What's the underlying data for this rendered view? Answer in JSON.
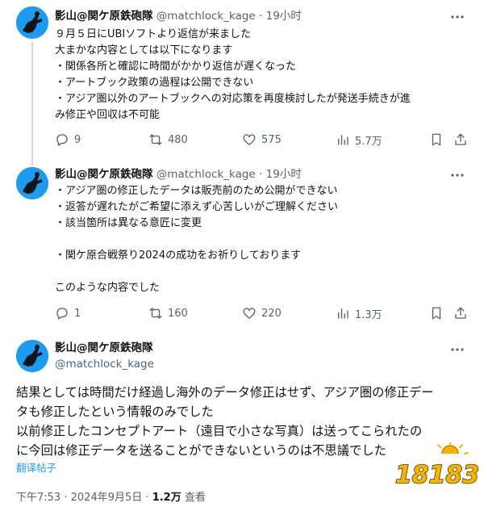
{
  "tweets": [
    {
      "name": "影山@関ケ原鉄砲隊",
      "handle": "@matchlock_kage",
      "dot": "·",
      "time": "19小时",
      "lines": [
        "９月５日にUBIソフトより返信が来ました",
        "大まかな内容としては以下になります",
        "・関係各所と確認に時間がかかり返信が遅くなった",
        "・アートブック政策の過程は公開できない",
        "・アジア圏以外のアートブックへの対応策を再度検討したが発送手続きが進",
        "み修正や回収は不可能"
      ],
      "stats": {
        "replies": "9",
        "retweets": "480",
        "likes": "575",
        "views": "5.7万"
      }
    },
    {
      "name": "影山@関ケ原鉄砲隊",
      "handle": "@matchlock_kage",
      "dot": "·",
      "time": "19小时",
      "lines": [
        "・アジア圏の修正したデータは販売前のため公開ができない",
        "・返答が遅れたがご希望に添えず心苦しいがご理解ください",
        "・該当箇所は異なる意匠に変更",
        "",
        "・関ケ原合戦祭り2024の成功をお祈りしております",
        "",
        "このような内容でした"
      ],
      "stats": {
        "replies": "1",
        "retweets": "160",
        "likes": "220",
        "views": "1.3万"
      }
    }
  ],
  "main_tweet": {
    "name": "影山@関ケ原鉄砲隊",
    "handle": "@matchlock_kage",
    "lines": [
      "結果としては時間だけ経過し海外のデータ修正はせず、アジア圏の修正デー",
      "タも修正したという情報のみでした",
      "以前修正したコンセプトアート（遠目で小さな写真）は送ってこられたの",
      "に今回は修正データを送ることができないというのは不思議でした"
    ],
    "translate_label": "翻译帖子",
    "footer": {
      "time": "下午7:53",
      "dot1": "·",
      "date": "2024年9月5日",
      "dot2": "·",
      "views_count": "1.2万",
      "views_label": "查看"
    }
  },
  "watermark": {
    "text": "18183"
  },
  "colors": {
    "accent": "#1d9bf0",
    "text": "#0f1419",
    "muted": "#536471",
    "line": "#cfd9de"
  }
}
